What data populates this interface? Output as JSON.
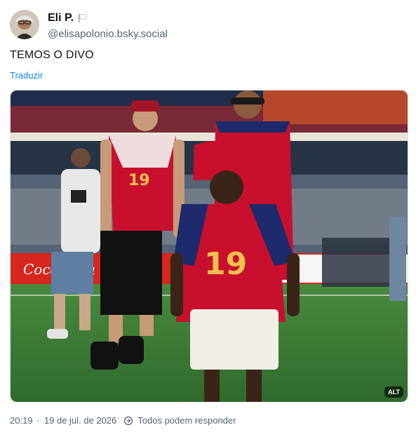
{
  "author": {
    "display_name": "Eli P.",
    "handle": "@elisapolonio.bsky.social"
  },
  "post": {
    "text": "TEMOS O DIVO",
    "translate_label": "Traduzir"
  },
  "media": {
    "alt_badge": "ALT",
    "jersey_number_large": "19",
    "jersey_number_small": "19",
    "jersey_number_back": "19",
    "sign_left": "Coca-Cola"
  },
  "meta": {
    "timestamp": "20:19",
    "separator": "·",
    "date": "19 de jul. de 2026",
    "reply_setting": "Todos podem responder"
  },
  "colors": {
    "link": "#1083fe",
    "muted": "#536471",
    "spain_red": "#c8102e",
    "spain_navy": "#1d2a6b",
    "pitch": "#3f7d37"
  },
  "icons": {
    "flag": "flag-icon",
    "reply": "reply-settings-icon",
    "avatar": "avatar"
  }
}
